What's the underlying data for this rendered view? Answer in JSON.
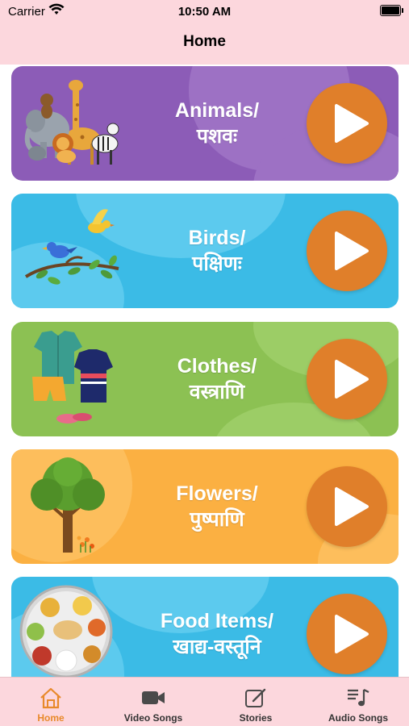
{
  "status_bar": {
    "carrier": "Carrier",
    "time": "10:50 AM"
  },
  "nav": {
    "title": "Home"
  },
  "cards": [
    {
      "title_en": "Animals/",
      "title_sa": "पशवः",
      "bg": "#8c5cb7",
      "blob": "#9d71c4",
      "illustration": "animals-illustration"
    },
    {
      "title_en": "Birds/",
      "title_sa": "पक्षिणः",
      "bg": "#3bbbe6",
      "blob": "#5ccaee",
      "illustration": "birds-illustration"
    },
    {
      "title_en": "Clothes/",
      "title_sa": "वस्त्राणि",
      "bg": "#8cc153",
      "blob": "#9ccd66",
      "illustration": "clothes-illustration"
    },
    {
      "title_en": "Flowers/",
      "title_sa": "पुष्पाणि",
      "bg": "#fbb042",
      "blob": "#fdbe5c",
      "illustration": "tree-illustration"
    },
    {
      "title_en": "Food Items/",
      "title_sa": "खाद्य-वस्तूनि",
      "bg": "#3bbbe6",
      "blob": "#5ccaee",
      "illustration": "food-plate-illustration"
    }
  ],
  "tabs": [
    {
      "label": "Home",
      "icon": "home-icon",
      "active": true
    },
    {
      "label": "Video Songs",
      "icon": "video-camera-icon",
      "active": false
    },
    {
      "label": "Stories",
      "icon": "edit-icon",
      "active": false
    },
    {
      "label": "Audio Songs",
      "icon": "music-list-icon",
      "active": false
    }
  ],
  "colors": {
    "header_bg": "#fcd7dd",
    "play_button": "#e07f2a",
    "active_tab": "#e8892a"
  }
}
